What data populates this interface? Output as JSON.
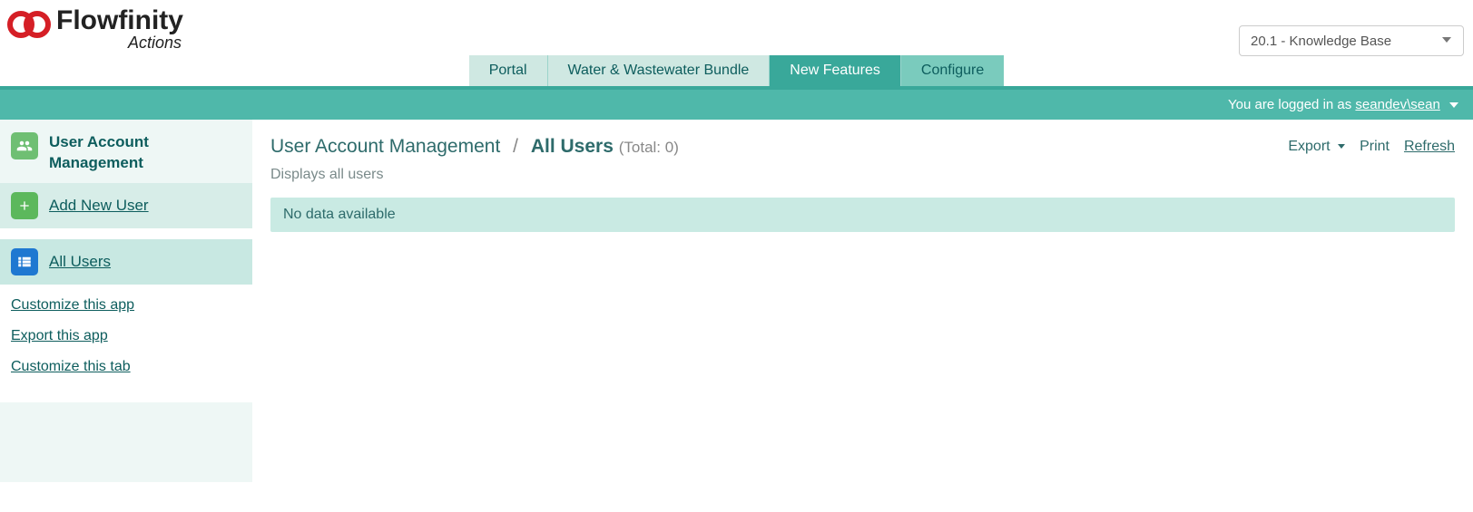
{
  "header": {
    "logo_main": "Flowfinity",
    "logo_sub": "Actions",
    "kb_select": "20.1 - Knowledge Base"
  },
  "tabs": [
    {
      "label": "Portal",
      "active": false
    },
    {
      "label": "Water & Wastewater Bundle",
      "active": false
    },
    {
      "label": "New Features",
      "active": true
    },
    {
      "label": "Configure",
      "active": false
    }
  ],
  "login_bar": {
    "prefix": "You are logged in as ",
    "user": "seandev\\sean"
  },
  "sidebar": {
    "app_title": "User Account Management",
    "add_user": "Add New User",
    "all_users": "All Users",
    "links": {
      "customize_app": "Customize this app",
      "export_app": "Export this app",
      "customize_tab": "Customize this tab"
    }
  },
  "main": {
    "breadcrumb_root": "User Account Management",
    "breadcrumb_current": "All Users",
    "total_label": "(Total: 0)",
    "subtitle": "Displays all users",
    "no_data": "No data available",
    "actions": {
      "export": "Export",
      "print": "Print",
      "refresh": "Refresh"
    }
  }
}
